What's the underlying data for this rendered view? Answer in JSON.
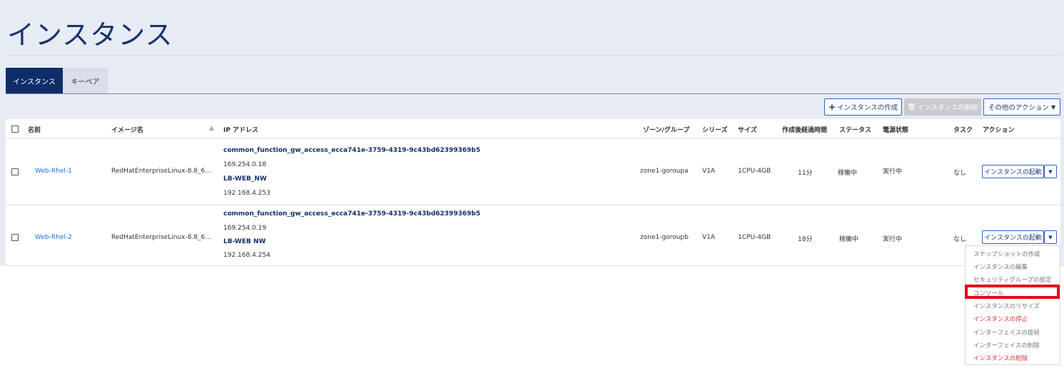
{
  "page_title": "インスタンス",
  "tabs": [
    "インスタンス",
    "キーペア"
  ],
  "toolbar": {
    "create": "インスタンスの作成",
    "delete": "インスタンスの削除",
    "other": "その他のアクション"
  },
  "columns": [
    "名前",
    "イメージ名",
    "IP アドレス",
    "ゾーン/グループ",
    "シリーズ",
    "サイズ",
    "作成後経過時間",
    "ステータス",
    "電源状態",
    "タスク",
    "アクション"
  ],
  "rows": [
    {
      "name": "Web-Rhel-1",
      "image": "RedHatEnterpriseLinux-8.8_6...",
      "net1": "common_function_gw_access_ecca741e-3759-4319-9c43bd62399369b5",
      "ip1": "169.254.0.18",
      "net2": "LB-WEB_NW",
      "ip2": "192.168.4.253",
      "zone": "zone1-goroupa",
      "series": "V1A",
      "size": "1CPU-4GB",
      "elapsed": "11分",
      "status": "稼働中",
      "power": "実行中",
      "task": "なし",
      "action": "インスタンスの起動"
    },
    {
      "name": "Web-Rhel-2",
      "image": "RedHatEnterpriseLinux-8.8_6...",
      "net1": "common_function_gw_access_ecca741e-3759-4319-9c43bd62399369b5",
      "ip1": "169.254.0.19",
      "net2": "LB-WEB NW",
      "ip2": "192.168.4.254",
      "zone": "zone1-goroupb",
      "series": "V1A",
      "size": "1CPU-4GB",
      "elapsed": "18分",
      "status": "稼働中",
      "power": "実行中",
      "task": "なし",
      "action": "インスタンスの起動"
    }
  ],
  "menu": [
    {
      "label": "スナップショットの作成",
      "danger": false
    },
    {
      "label": "インスタンスの編集",
      "danger": false
    },
    {
      "label": "セキュリティグループの設定",
      "danger": false
    },
    {
      "label": "コンソール",
      "danger": false,
      "highlighted": true
    },
    {
      "label": "インスタンスのリサイズ",
      "danger": false
    },
    {
      "label": "インスタンスの停止",
      "danger": true
    },
    {
      "label": "インターフェイスの接続",
      "danger": false
    },
    {
      "label": "インターフェイスの削除",
      "danger": false
    },
    {
      "label": "インスタンスの削除",
      "danger": true
    }
  ]
}
